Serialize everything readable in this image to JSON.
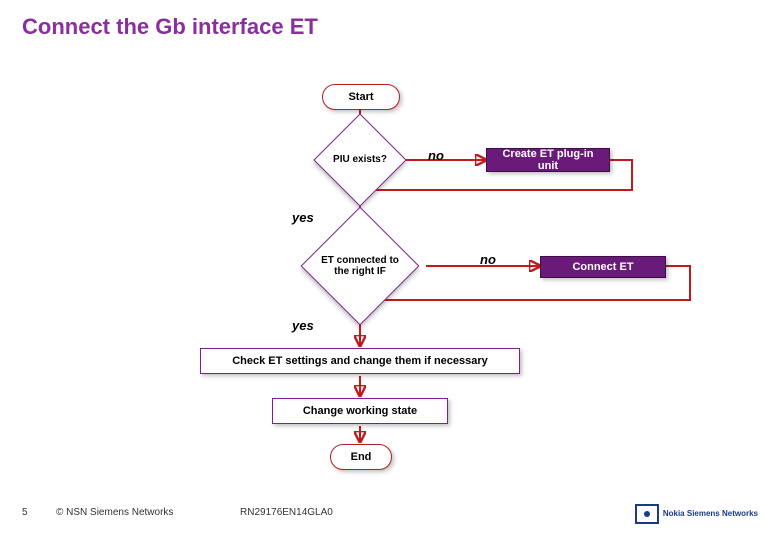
{
  "title": "Connect the Gb interface ET",
  "flow": {
    "start": "Start",
    "decision1": "PIU exists?",
    "process1": "Create ET plug-in unit",
    "decision2": "ET connected to the right IF",
    "process2": "Connect ET",
    "check": "Check ET settings and change them if necessary",
    "change": "Change working state",
    "end": "End",
    "no1": "no",
    "yes1": "yes",
    "no2": "no",
    "yes2": "yes"
  },
  "colors": {
    "purple": "#6a1b7a",
    "purple_line": "#7a1f8f",
    "red": "#c21a1a",
    "red_border": "#b22222"
  },
  "footer": {
    "page": "5",
    "copyright": "© NSN Siemens Networks",
    "doc": "RN29176EN14GLA0",
    "logo_text": "Nokia Siemens Networks"
  },
  "chart_data": {
    "type": "flowchart",
    "nodes": [
      {
        "id": "start",
        "kind": "terminator",
        "label": "Start"
      },
      {
        "id": "d1",
        "kind": "decision",
        "label": "PIU exists?"
      },
      {
        "id": "p1",
        "kind": "process",
        "label": "Create ET plug-in unit"
      },
      {
        "id": "d2",
        "kind": "decision",
        "label": "ET connected to the right IF"
      },
      {
        "id": "p2",
        "kind": "process",
        "label": "Connect ET"
      },
      {
        "id": "check",
        "kind": "process-highlight",
        "label": "Check ET settings and change them if necessary"
      },
      {
        "id": "change",
        "kind": "process-highlight",
        "label": "Change working state"
      },
      {
        "id": "end",
        "kind": "terminator",
        "label": "End"
      }
    ],
    "edges": [
      {
        "from": "start",
        "to": "d1",
        "label": ""
      },
      {
        "from": "d1",
        "to": "p1",
        "label": "no"
      },
      {
        "from": "p1",
        "to": "d1",
        "label": ""
      },
      {
        "from": "d1",
        "to": "d2",
        "label": "yes"
      },
      {
        "from": "d2",
        "to": "p2",
        "label": "no"
      },
      {
        "from": "p2",
        "to": "d2",
        "label": ""
      },
      {
        "from": "d2",
        "to": "check",
        "label": "yes"
      },
      {
        "from": "check",
        "to": "change",
        "label": ""
      },
      {
        "from": "change",
        "to": "end",
        "label": ""
      }
    ]
  }
}
